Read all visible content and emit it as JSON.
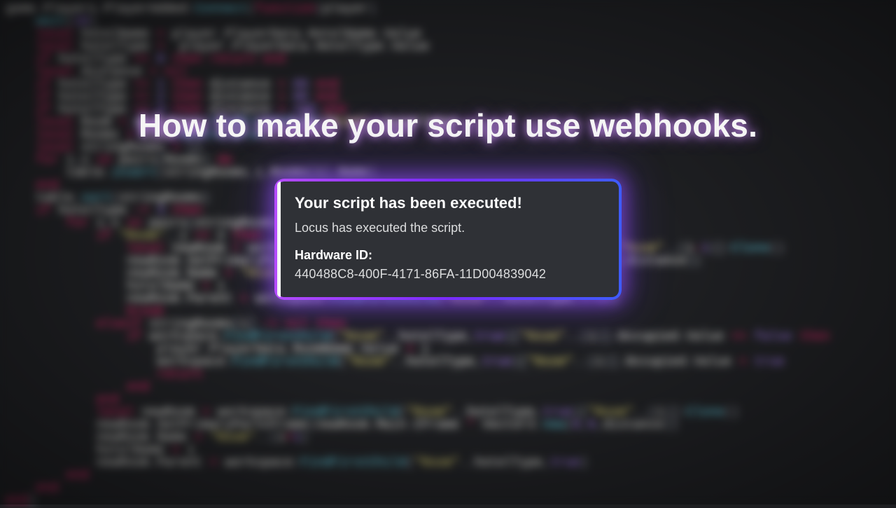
{
  "title": "How to make your script use webhooks.",
  "embed": {
    "title": "Your script has been executed!",
    "description": "Locus has executed the script.",
    "field_name": "Hardware ID:",
    "field_value": "440488C8-400F-4171-86FA-11D004839042"
  }
}
